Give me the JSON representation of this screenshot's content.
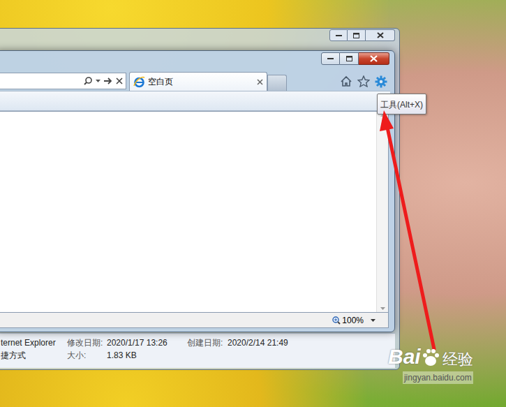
{
  "ie": {
    "tab": {
      "label": "空白页",
      "selected": true
    },
    "tooltip": "工具(Alt+X)",
    "status_bar": {
      "zoom": "100%"
    }
  },
  "details_pane": {
    "rows": [
      [
        "ternet Explorer",
        "修改日期:",
        "2020/1/17 13:26",
        "创建日期:",
        "2020/2/14 21:49"
      ],
      [
        "捷方式",
        "大小:",
        "1.83 KB"
      ]
    ]
  },
  "watermark": {
    "brand": "Bai",
    "product": "经验",
    "url": "jingyan.baidu.com"
  }
}
